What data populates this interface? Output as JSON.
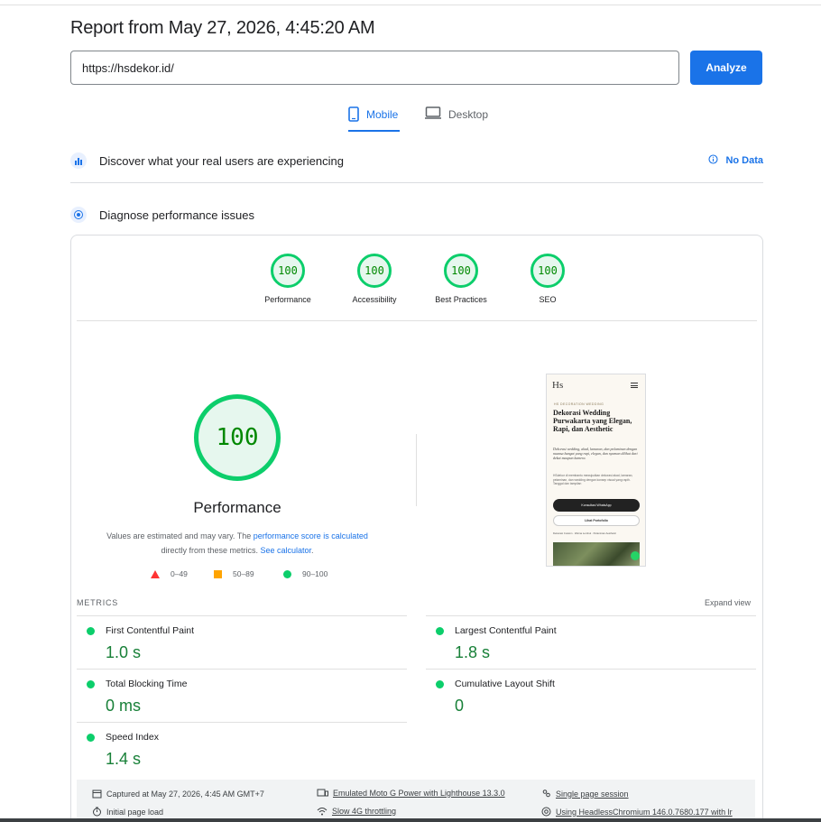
{
  "header": {
    "report_title": "Report from May 27, 2026, 4:45:20 AM",
    "url_value": "https://hsdekor.id/",
    "analyze_label": "Analyze"
  },
  "tabs": [
    {
      "label": "Mobile",
      "active": true
    },
    {
      "label": "Desktop",
      "active": false
    }
  ],
  "field_data": {
    "title": "Discover what your real users are experiencing",
    "status": "No Data"
  },
  "lab": {
    "title": "Diagnose performance issues",
    "categories": [
      {
        "label": "Performance",
        "score": "100"
      },
      {
        "label": "Accessibility",
        "score": "100"
      },
      {
        "label": "Best Practices",
        "score": "100"
      },
      {
        "label": "SEO",
        "score": "100"
      }
    ],
    "main_score": "100",
    "main_label": "Performance",
    "note_prefix": "Values are estimated and may vary. The ",
    "note_link1": "performance score is calculated",
    "note_mid": "directly from these metrics. ",
    "note_link2": "See calculator",
    "note_suffix": ".",
    "legend": [
      "0–49",
      "50–89",
      "90–100"
    ],
    "metrics_label": "METRICS",
    "expand_label": "Expand view",
    "metrics": [
      {
        "name": "First Contentful Paint",
        "value": "1.0 s"
      },
      {
        "name": "Largest Contentful Paint",
        "value": "1.8 s"
      },
      {
        "name": "Total Blocking Time",
        "value": "0 ms"
      },
      {
        "name": "Cumulative Layout Shift",
        "value": "0"
      },
      {
        "name": "Speed Index",
        "value": "1.4 s"
      }
    ],
    "footer": {
      "captured": "Captured at May 27, 2026, 4:45 AM GMT+7",
      "device": "Emulated Moto G Power with Lighthouse 13.3.0",
      "session": "Single page session",
      "load": "Initial page load",
      "throttling": "Slow 4G throttling",
      "browser": "Using HeadlessChromium 146.0.7680.177 with lr"
    }
  },
  "screenshot": {
    "logo": "Hs",
    "kicker": "HS DECORATION WEDDING",
    "heading": "Dekorasi Wedding Purwakarta yang Elegan, Rapi, dan Aesthetic",
    "tagline": "Dekorasi wedding, akad, lamaran, dan pelaminan dengan nuansa hangat yang rapi, elegan, dan nyaman dilihat dari dekat maupun kamera.",
    "body": "HSdekor di membantu mewujudkan dekorasi akad, lamaran, pelaminan, dan wedding dengan konsep visual yang rapih. Tanggal dan tampilan",
    "cta": "Konsultasi WhatsApp",
    "portfolio": "Lihat Portofolio",
    "links": "Dekorasi Custom · Warna Lembut · Pelaminan Aesthetic"
  }
}
